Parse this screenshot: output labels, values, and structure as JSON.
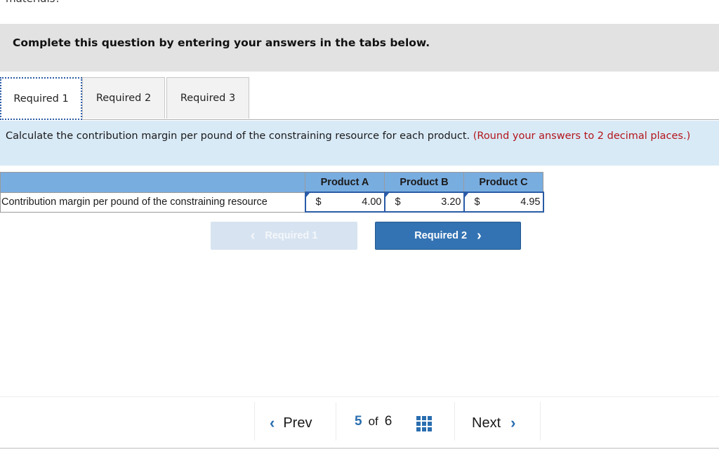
{
  "clipped_heading": "materials?",
  "banner": {
    "text": "Complete this question by entering your answers in the tabs below."
  },
  "tabs": [
    {
      "label": "Required 1",
      "active": true
    },
    {
      "label": "Required 2",
      "active": false
    },
    {
      "label": "Required 3",
      "active": false
    }
  ],
  "instructions": {
    "text": "Calculate the contribution margin per pound of the constraining resource for each product.",
    "note": "(Round your answers to 2 decimal places.)"
  },
  "table": {
    "columns": [
      "Product A",
      "Product B",
      "Product C"
    ],
    "rows": [
      {
        "label": "Contribution margin per pound of the constraining resource",
        "cells": [
          {
            "currency": "$",
            "value": "4.00"
          },
          {
            "currency": "$",
            "value": "3.20"
          },
          {
            "currency": "$",
            "value": "4.95"
          }
        ]
      }
    ]
  },
  "nav_buttons": {
    "prev_label": "Required 1",
    "next_label": "Required 2",
    "prev_icon": "‹",
    "next_icon": "›"
  },
  "pager": {
    "prev_label": "Prev",
    "next_label": "Next",
    "current": "5",
    "of": "of",
    "total": "6",
    "prev_icon": "‹",
    "next_icon": "›"
  }
}
